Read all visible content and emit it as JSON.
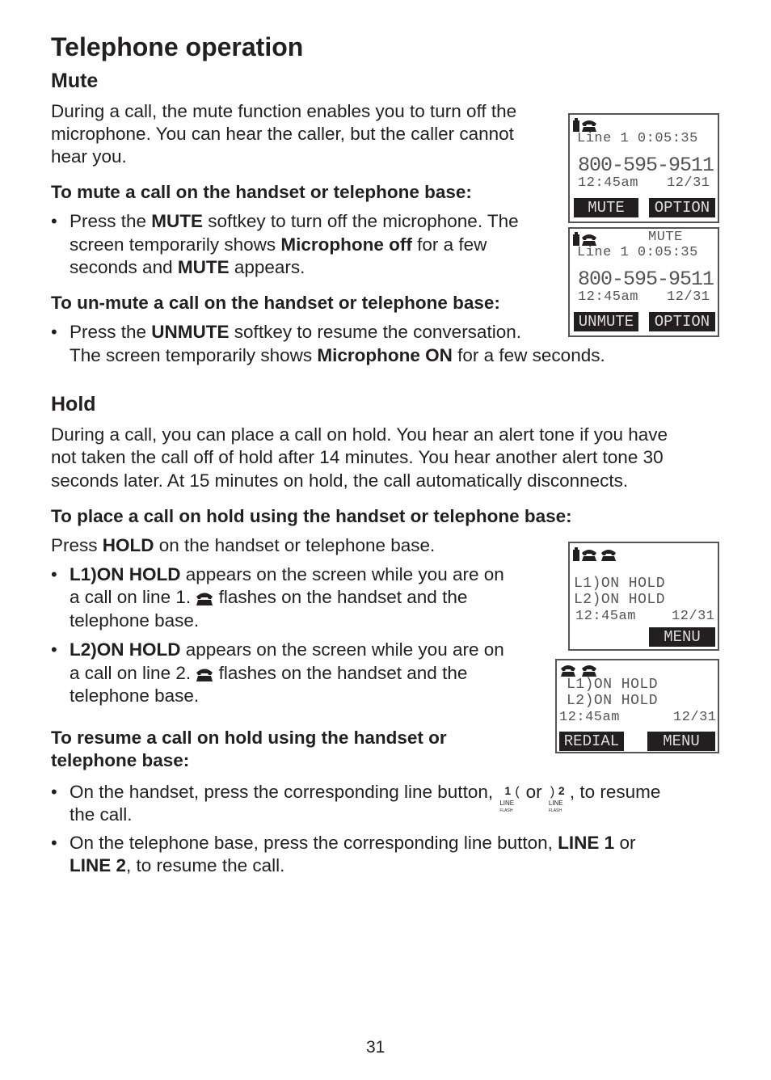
{
  "title": "Telephone operation",
  "mute": {
    "heading": "Mute",
    "lines": [
      [
        {
          "t": "During a call, the mute function enables you to turn off the"
        }
      ],
      [
        {
          "t": "microphone. You can hear the caller, but the caller cannot"
        }
      ],
      [
        {
          "t": "hear you."
        }
      ],
      [
        {
          "t": "To mute a call on the handset or telephone base:",
          "b": true
        }
      ],
      [
        {
          "t": "Press the "
        },
        {
          "t": "MUTE",
          "b": true
        },
        {
          "t": " softkey to turn off the microphone. The"
        }
      ],
      [
        {
          "t": "screen temporarily shows "
        },
        {
          "t": "Microphone off",
          "b": true
        },
        {
          "t": " for a few"
        }
      ],
      [
        {
          "t": "seconds and "
        },
        {
          "t": "MUTE",
          "b": true
        },
        {
          "t": " appears."
        }
      ],
      [
        {
          "t": "To un-mute a call on the handset or telephone base:",
          "b": true
        }
      ],
      [
        {
          "t": "Press the "
        },
        {
          "t": "UNMUTE",
          "b": true
        },
        {
          "t": " softkey to resume the conversation."
        }
      ],
      [
        {
          "t": "The screen temporarily shows "
        },
        {
          "t": "Microphone ON",
          "b": true
        },
        {
          "t": " for a few seconds."
        }
      ]
    ]
  },
  "hold": {
    "heading": "Hold",
    "lines": [
      [
        {
          "t": "During a call, you can place a call on hold. You hear an alert tone if you have"
        }
      ],
      [
        {
          "t": "not taken the call off of hold after 14 minutes. You hear another alert tone 30"
        }
      ],
      [
        {
          "t": "seconds later. At 15 minutes on hold, the call automatically disconnects."
        }
      ],
      [
        {
          "t": "To place a call on hold using the handset or telephone base:",
          "b": true
        }
      ],
      [
        {
          "t": "Press "
        },
        {
          "t": "HOLD",
          "b": true
        },
        {
          "t": " on the handset or telephone base."
        }
      ],
      [
        {
          "t": "L1)ON HOLD",
          "b": true
        },
        {
          "t": " appears on the screen while you are on"
        }
      ],
      [
        {
          "t": "a call on line 1. "
        },
        {
          "icon": "phone-icon"
        },
        {
          "t": "  flashes on the handset and the"
        }
      ],
      [
        {
          "t": "telephone base."
        }
      ],
      [
        {
          "t": "L2)ON HOLD",
          "b": true
        },
        {
          "t": " appears on the screen while you are on"
        }
      ],
      [
        {
          "t": "a call on line 2. "
        },
        {
          "icon": "phone-icon"
        },
        {
          "t": "  flashes on the handset and the"
        }
      ],
      [
        {
          "t": "telephone base."
        }
      ],
      [
        {
          "t": "To resume a call on hold using the handset or",
          "b": true
        }
      ],
      [
        {
          "t": "telephone base:",
          "b": true
        }
      ],
      [
        {
          "t": "On the handset, press the corresponding line button, "
        },
        {
          "icon": "line1-button-icon"
        },
        {
          "t": " or "
        },
        {
          "icon": "line2-button-icon"
        },
        {
          "t": ", to resume"
        }
      ],
      [
        {
          "t": "the call."
        }
      ],
      [
        {
          "t": "On the telephone base, press the corresponding line button, "
        },
        {
          "t": "LINE 1",
          "b": true
        },
        {
          "t": " or"
        }
      ],
      [
        {
          "t": "LINE 2",
          "b": true
        },
        {
          "t": ", to resume the call."
        }
      ]
    ]
  },
  "bullet": "•",
  "line_button": {
    "label": "LINE",
    "sub": "FLASH",
    "n1": "1",
    "n2": "2"
  },
  "screens": {
    "s1": {
      "line": "Line 1  0:05:35",
      "number": "800-595-9511",
      "time": "12:45am",
      "date": "12/31",
      "left": "MUTE",
      "right": "OPTION"
    },
    "s2": {
      "status": "MUTE",
      "line": "Line 1  0:05:35",
      "number": "800-595-9511",
      "time": "12:45am",
      "date": "12/31",
      "left": "UNMUTE",
      "right": "OPTION"
    },
    "s3": {
      "l1": "L1)ON HOLD",
      "l2": "L2)ON HOLD",
      "time": "12:45am",
      "date": "12/31",
      "right": "MENU"
    },
    "s4": {
      "l1": "L1)ON HOLD",
      "l2": "L2)ON HOLD",
      "time": "12:45am",
      "date": "12/31",
      "left": "REDIAL",
      "right": "MENU"
    }
  },
  "page_number": "31"
}
